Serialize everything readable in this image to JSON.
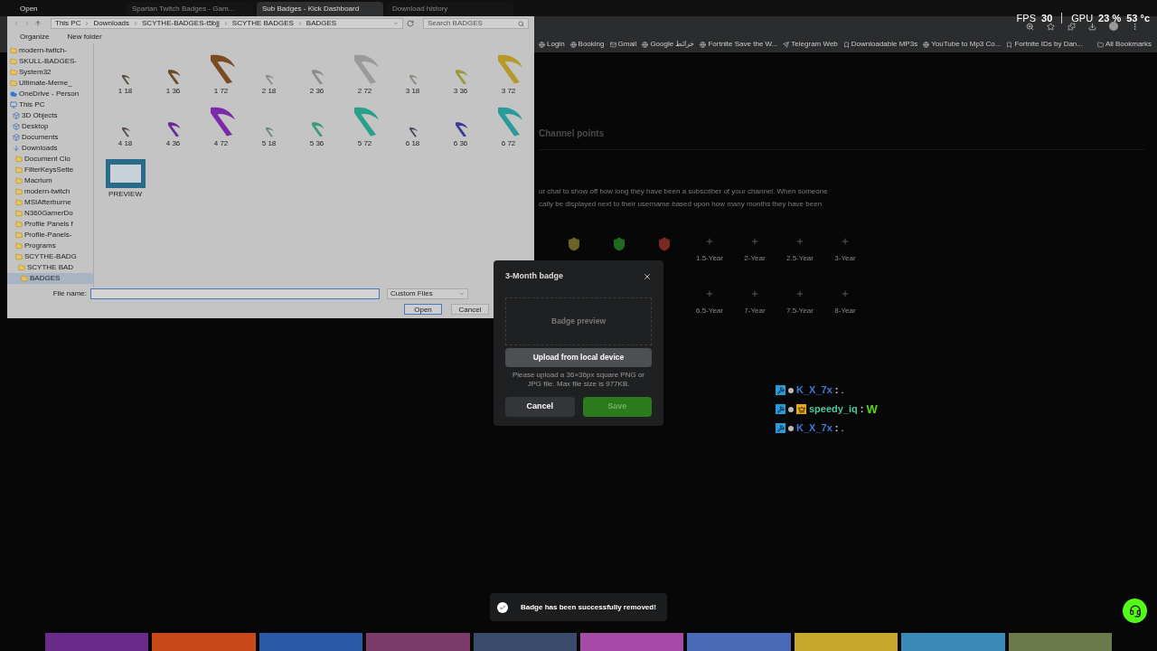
{
  "browser": {
    "tabs": [
      {
        "title": "Spartan Twitch Badges - Gam...",
        "selected": false
      },
      {
        "title": "Sub Badges - Kick Dashboard",
        "selected": true
      },
      {
        "title": "Download history",
        "selected": false
      }
    ],
    "bookmarks": [
      "Login",
      "Booking",
      "Gmail",
      "Google خرائط",
      "Fortnite Save the W...",
      "Telegram Web",
      "Downloadable MP3s",
      "YouTube to Mp3 Co...",
      "Fortnite IDs by Dan..."
    ],
    "all_bookmarks": "All Bookmarks"
  },
  "perf_overlay": {
    "fps_label": "FPS",
    "fps": "30",
    "gpu_label": "GPU",
    "gpu_usage": "23 %",
    "gpu_temp": "53 °c"
  },
  "file_dialog": {
    "title": "Open",
    "breadcrumb": [
      "This PC",
      "Downloads",
      "SCYTHE-BADGES-t5bjj",
      "SCYTHE BADGES",
      "BADGES"
    ],
    "search_placeholder": "Search BADGES",
    "toolbar": [
      "Organize",
      "New folder"
    ],
    "tree": [
      {
        "label": "modern-twitch-",
        "kind": "folder",
        "selected": false
      },
      {
        "label": "SKULL-BADGES-",
        "kind": "folder",
        "selected": false
      },
      {
        "label": "System32",
        "kind": "folder",
        "selected": false
      },
      {
        "label": "Ultimate-Meme_",
        "kind": "folder",
        "selected": false
      },
      {
        "label": "OneDrive - Person",
        "kind": "cloud",
        "selected": false
      },
      {
        "label": "This PC",
        "kind": "pc",
        "selected": false,
        "children": [
          {
            "label": "3D Objects",
            "kind": "drive",
            "selected": false
          },
          {
            "label": "Desktop",
            "kind": "drive",
            "selected": false
          },
          {
            "label": "Documents",
            "kind": "drive",
            "selected": false
          },
          {
            "label": "Downloads",
            "kind": "download",
            "selected": false,
            "children": [
              {
                "label": "Document Clo",
                "kind": "folder",
                "selected": false
              },
              {
                "label": "FilterKeysSette",
                "kind": "folder",
                "selected": false
              },
              {
                "label": "Macrium",
                "kind": "folder",
                "selected": false
              },
              {
                "label": "modern-twitch",
                "kind": "folder",
                "selected": false
              },
              {
                "label": "MSIAfterburne",
                "kind": "folder",
                "selected": false
              },
              {
                "label": "N360GamerDo",
                "kind": "folder",
                "selected": false
              },
              {
                "label": "Profile Panels f",
                "kind": "folder",
                "selected": false
              },
              {
                "label": "Profile-Panels-",
                "kind": "folder",
                "selected": false
              },
              {
                "label": "Programs",
                "kind": "folder",
                "selected": false
              },
              {
                "label": "SCYTHE-BADG",
                "kind": "folder",
                "selected": false,
                "children": [
                  {
                    "label": "SCYTHE BAD",
                    "kind": "folder",
                    "selected": false,
                    "children": [
                      {
                        "label": "BADGES",
                        "kind": "folder",
                        "selected": true
                      }
                    ]
                  }
                ]
              }
            ]
          }
        ]
      }
    ],
    "files": [
      {
        "name": "1 18",
        "kind": "small",
        "color": "#5a4a3a"
      },
      {
        "name": "1 36",
        "kind": "medium",
        "color": "#6b4a2a"
      },
      {
        "name": "1 72",
        "kind": "large",
        "color": "#7a4a22"
      },
      {
        "name": "2 18",
        "kind": "small",
        "color": "#8a8a8a"
      },
      {
        "name": "2 36",
        "kind": "medium",
        "color": "#8c8c8c"
      },
      {
        "name": "2 72",
        "kind": "large",
        "color": "#9a9a9a"
      },
      {
        "name": "3 18",
        "kind": "small",
        "color": "#8a8a7a"
      },
      {
        "name": "3 36",
        "kind": "medium",
        "color": "#9a9a3a"
      },
      {
        "name": "3 72",
        "kind": "large",
        "color": "#b59a2a"
      },
      {
        "name": "4 18",
        "kind": "small",
        "color": "#5a4a5a"
      },
      {
        "name": "4 36",
        "kind": "medium",
        "color": "#6a2a9a"
      },
      {
        "name": "4 72",
        "kind": "large",
        "color": "#7a2aaa"
      },
      {
        "name": "5 18",
        "kind": "small",
        "color": "#6a8a7a"
      },
      {
        "name": "5 36",
        "kind": "medium",
        "color": "#3a9a7a"
      },
      {
        "name": "5 72",
        "kind": "large",
        "color": "#2aa08a"
      },
      {
        "name": "6 18",
        "kind": "small",
        "color": "#4a4a5a"
      },
      {
        "name": "6 36",
        "kind": "medium",
        "color": "#3a3a9a"
      },
      {
        "name": "6 72",
        "kind": "large",
        "color": "#2a9a9a"
      },
      {
        "name": "PREVIEW",
        "kind": "preview",
        "color": "#2a6a8a"
      }
    ],
    "file_name_label": "File name:",
    "file_type": "Custom Files",
    "buttons": [
      "Open",
      "Cancel"
    ]
  },
  "page": {
    "tab": "Channel points",
    "description": [
      "ur chat to show off how long they have been a subscriber of your channel. When someone",
      "cally be displayed next to their username based upon how many months they have been"
    ],
    "badge_rows": [
      [
        {
          "kind": "image",
          "color": "#6b6426"
        },
        {
          "kind": "image",
          "color": "#1f6b22"
        },
        {
          "kind": "image",
          "color": "#7a2a1e"
        },
        {
          "kind": "empty",
          "label": "1.5-Year"
        },
        {
          "kind": "empty",
          "label": "2-Year"
        },
        {
          "kind": "empty",
          "label": "2.5-Year"
        },
        {
          "kind": "empty",
          "label": "3-Year"
        }
      ],
      [
        {
          "kind": "empty",
          "label": "6.5-Year"
        },
        {
          "kind": "empty",
          "label": "7-Year"
        },
        {
          "kind": "empty",
          "label": "7.5-Year"
        },
        {
          "kind": "empty",
          "label": "8-Year"
        }
      ]
    ]
  },
  "modal": {
    "title": "3-Month badge",
    "preview_label": "Badge preview",
    "upload_button": "Upload from local device",
    "help": "Please upload a 36×36px square PNG or JPG file. Max file size is 977KB.",
    "cancel": "Cancel",
    "save": "Save",
    "save_disabled": true
  },
  "chat": [
    {
      "user": "K_X_7x",
      "color": "#3d7bd9",
      "crown": false,
      "separator": ":",
      "message": ".",
      "kind": "text"
    },
    {
      "user": "speedy_iq",
      "color": "#53c8a0",
      "crown": true,
      "separator": ":",
      "message": "W",
      "kind": "emote"
    },
    {
      "user": "K_X_7x",
      "color": "#3d7bd9",
      "crown": false,
      "separator": ":",
      "message": ".",
      "kind": "text"
    }
  ],
  "toast": {
    "message": "Badge has been successfully removed!"
  }
}
